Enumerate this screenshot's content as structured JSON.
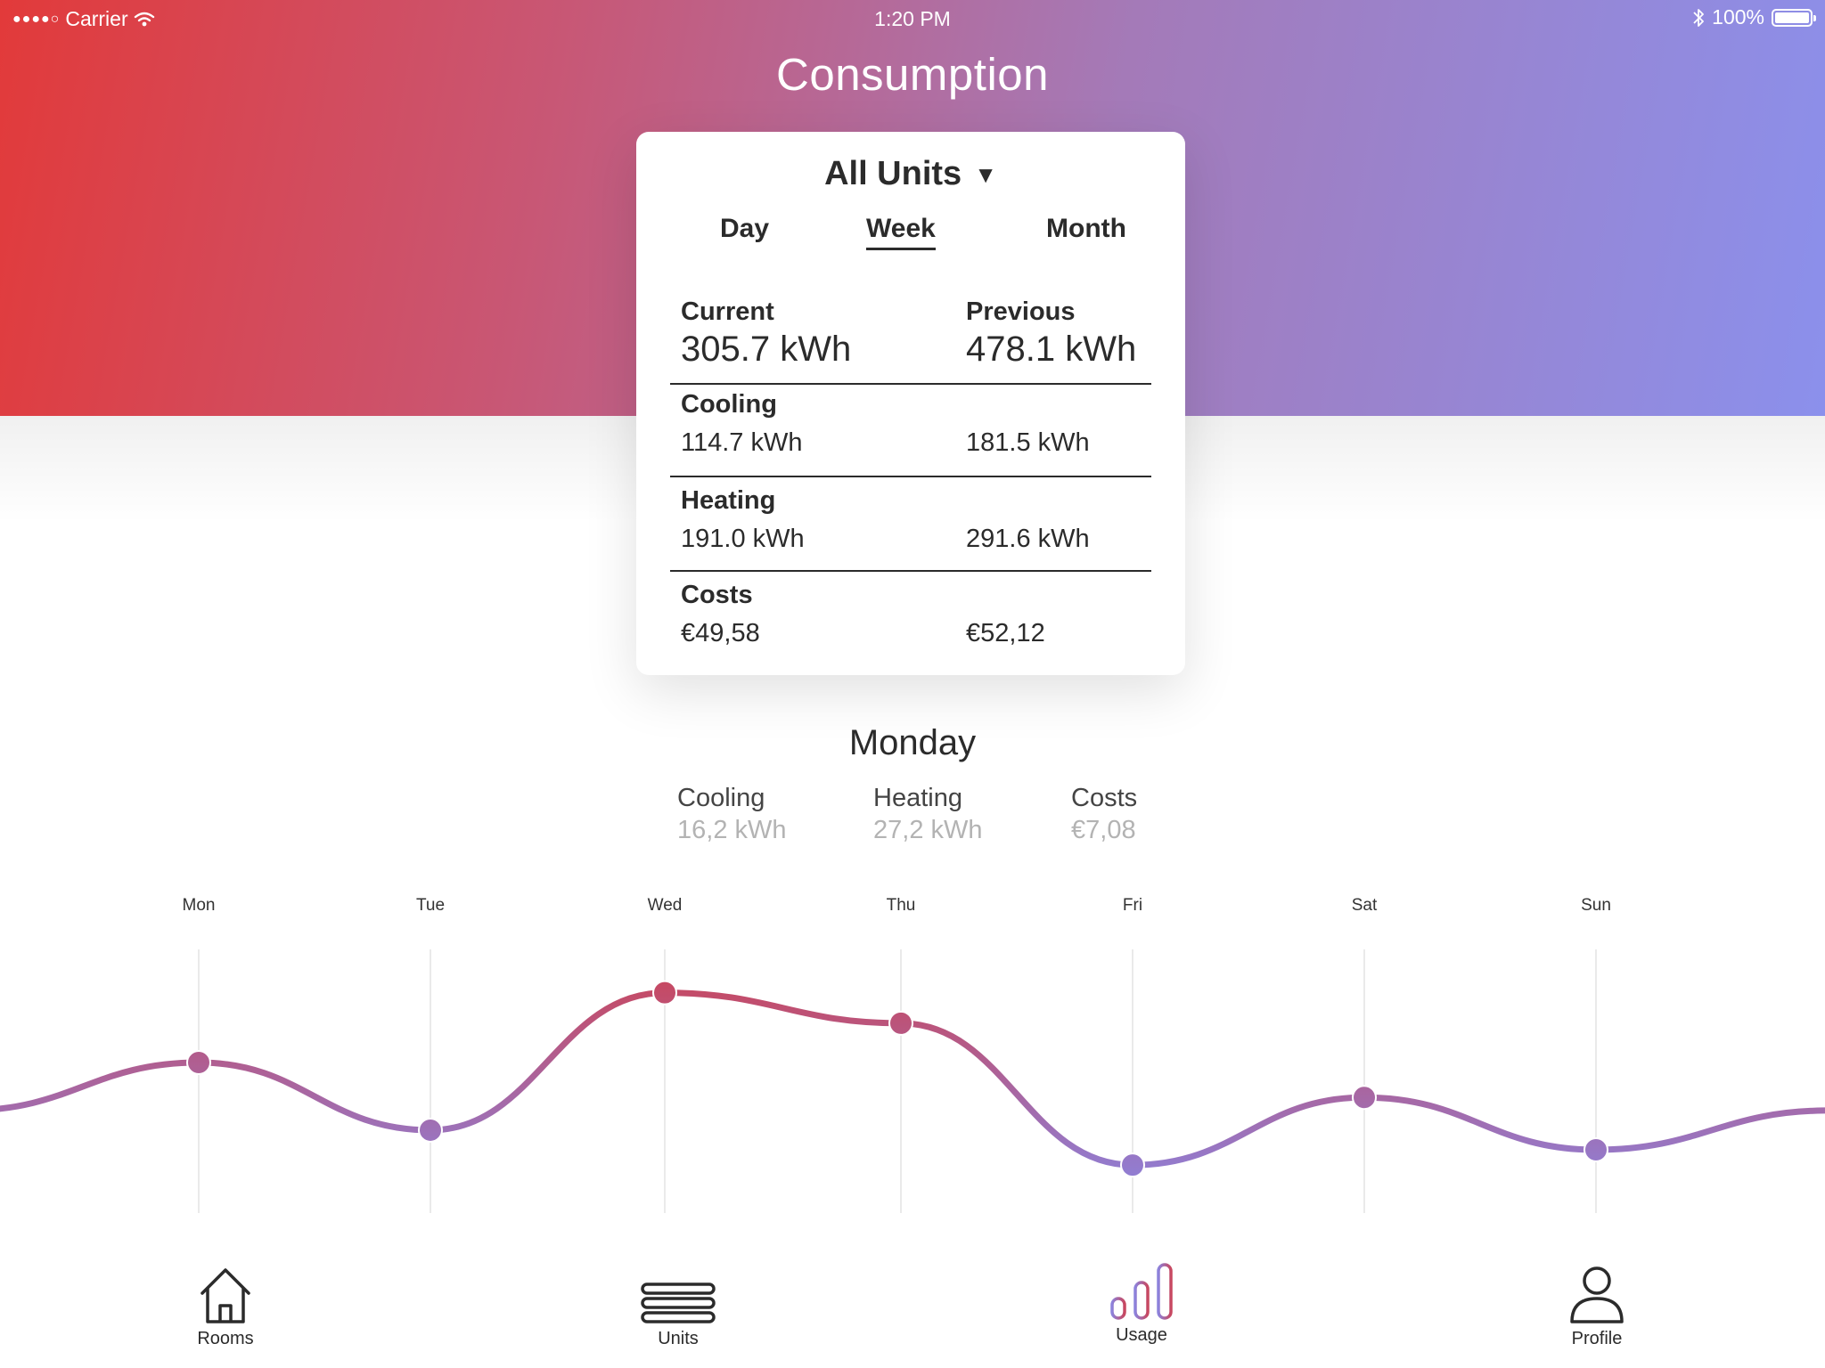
{
  "status_bar": {
    "carrier": "Carrier",
    "time": "1:20 PM",
    "battery": "100%"
  },
  "page": {
    "title": "Consumption"
  },
  "card": {
    "unit_selector": "All Units",
    "tabs": [
      {
        "label": "Day",
        "active": false
      },
      {
        "label": "Week",
        "active": true
      },
      {
        "label": "Month",
        "active": false
      }
    ],
    "current_label": "Current",
    "previous_label": "Previous",
    "current_total": "305.7 kWh",
    "previous_total": "478.1 kWh",
    "rows": [
      {
        "label": "Cooling",
        "current": "114.7 kWh",
        "previous": "181.5 kWh"
      },
      {
        "label": "Heating",
        "current": "191.0 kWh",
        "previous": "291.6 kWh"
      },
      {
        "label": "Costs",
        "current": "€49,58",
        "previous": "€52,12"
      }
    ]
  },
  "day_detail": {
    "title": "Monday",
    "stats": [
      {
        "label": "Cooling",
        "value": "16,2 kWh"
      },
      {
        "label": "Heating",
        "value": "27,2 kWh"
      },
      {
        "label": "Costs",
        "value": "€7,08"
      }
    ]
  },
  "chart_data": {
    "type": "line",
    "categories": [
      "Mon",
      "Tue",
      "Wed",
      "Thu",
      "Fri",
      "Sat",
      "Sun"
    ],
    "values": [
      0.6,
      0.29,
      0.92,
      0.78,
      0.13,
      0.44,
      0.2
    ],
    "ylim": [
      0,
      1
    ],
    "grid": true,
    "colors": {
      "high": "#c8475f",
      "low": "#8c82dc"
    }
  },
  "tabbar": {
    "items": [
      {
        "label": "Rooms",
        "icon": "home-icon",
        "active": false
      },
      {
        "label": "Units",
        "icon": "units-icon",
        "active": false
      },
      {
        "label": "Usage",
        "icon": "bar-chart-icon",
        "active": true
      },
      {
        "label": "Profile",
        "icon": "profile-icon",
        "active": false
      }
    ]
  }
}
